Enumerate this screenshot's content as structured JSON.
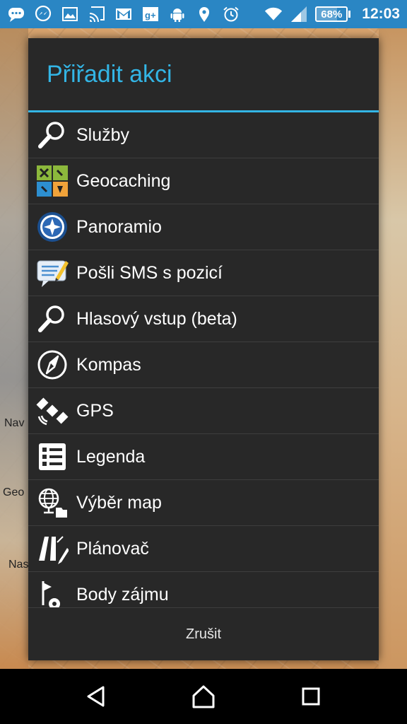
{
  "status_bar": {
    "battery": "68%",
    "battery_level": 0.68,
    "time": "12:03",
    "icons": [
      "chat-bubble-icon",
      "messenger-icon",
      "image-icon",
      "cast-icon",
      "gmail-icon",
      "google-plus-icon",
      "android-icon",
      "location-pin-icon",
      "alarm-icon",
      "wifi-icon",
      "signal-icon"
    ]
  },
  "map": {
    "labels": [
      "Nav",
      "Geo",
      "Nas"
    ]
  },
  "dialog": {
    "title": "Přiřadit akci",
    "items": [
      {
        "label": "Služby",
        "icon": "search-icon"
      },
      {
        "label": "Geocaching",
        "icon": "geocaching-icon"
      },
      {
        "label": "Panoramio",
        "icon": "panoramio-icon"
      },
      {
        "label": "Pošli SMS s pozicí",
        "icon": "sms-icon"
      },
      {
        "label": "Hlasový vstup (beta)",
        "icon": "search-icon"
      },
      {
        "label": "Kompas",
        "icon": "compass-icon"
      },
      {
        "label": "GPS",
        "icon": "satellite-icon"
      },
      {
        "label": "Legenda",
        "icon": "legend-list-icon"
      },
      {
        "label": "Výběr map",
        "icon": "globe-icon"
      },
      {
        "label": "Plánovač",
        "icon": "route-planner-icon"
      },
      {
        "label": "Body zájmu",
        "icon": "poi-icon"
      }
    ],
    "cancel_label": "Zrušit"
  },
  "colors": {
    "accent": "#33b5e5",
    "status_bar": "#2a86c4",
    "dialog_bg": "#282828"
  }
}
